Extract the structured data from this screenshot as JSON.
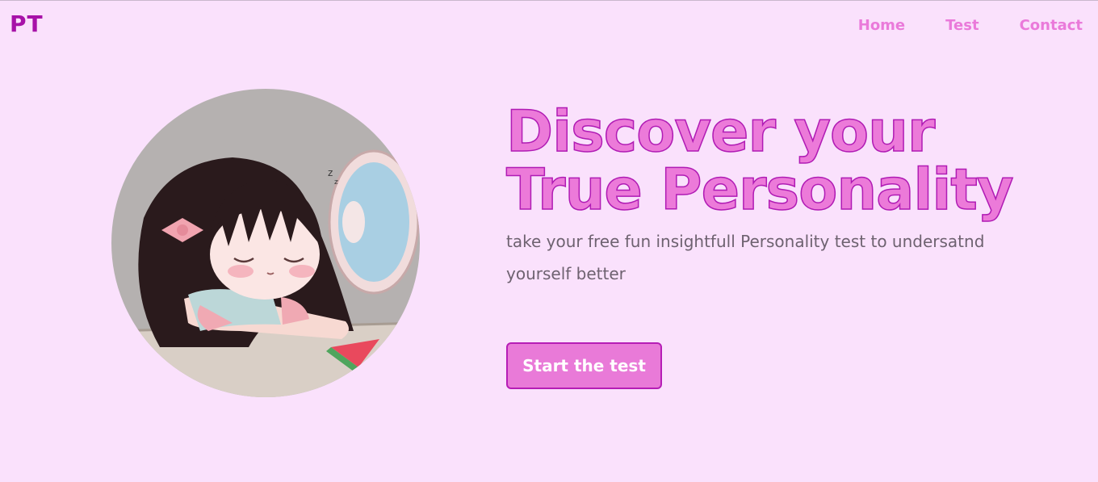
{
  "brand": {
    "logo_text": "PT"
  },
  "nav": {
    "items": [
      {
        "label": "Home"
      },
      {
        "label": "Test"
      },
      {
        "label": "Contact"
      }
    ]
  },
  "hero": {
    "headline": "Discover your True Personality",
    "subtext": "take your free fun insightfull Personality test to undersatnd yourself better",
    "cta_label": "Start the test",
    "image_icon": "sleeping-girl-illustration"
  },
  "colors": {
    "background": "#fae1fc",
    "logo": "#a712a8",
    "nav_link": "#ea7ada",
    "headline_fill": "#ec7ad9",
    "headline_stroke": "#b01bb4",
    "button_bg": "#e97ad8",
    "button_border": "#b61db6"
  }
}
